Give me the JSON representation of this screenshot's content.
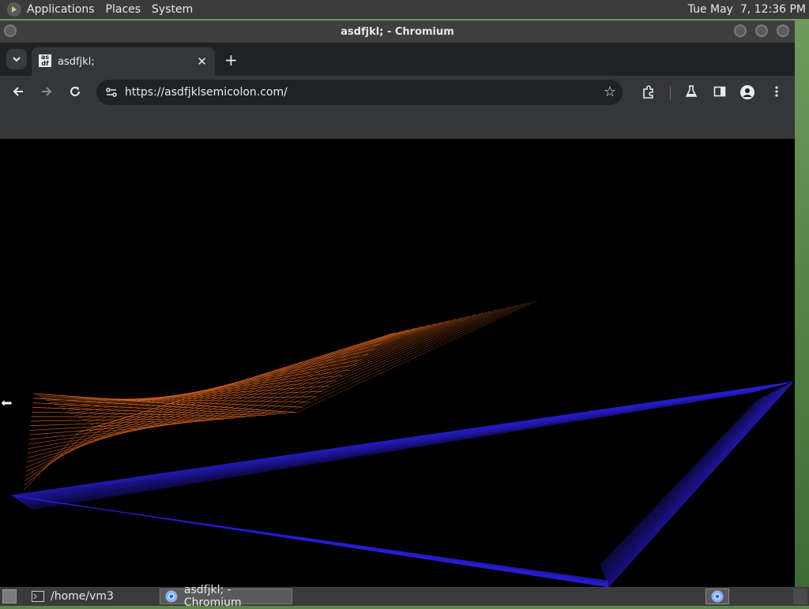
{
  "top_panel": {
    "menus": [
      "Applications",
      "Places",
      "System"
    ],
    "clock": "Tue May  7, 12:36 PM"
  },
  "window": {
    "title": "asdfjkl; - Chromium"
  },
  "browser": {
    "tab": {
      "favicon_text": "as df",
      "title": "asdfjkl;"
    },
    "new_tab": "+",
    "url": "https://asdfjklsemicolon.com/"
  },
  "content": {
    "background": "#000000",
    "orange": "#e0661e",
    "blue": "#2a1fd8"
  },
  "taskbar": {
    "items": [
      {
        "label": "/home/vm3"
      },
      {
        "label": "asdfjkl; - Chromium"
      }
    ]
  },
  "icons": [
    "distro-logo-icon",
    "tab-list-icon",
    "favicon-icon",
    "close-tab-icon",
    "new-tab-icon",
    "back-icon",
    "forward-icon",
    "reload-icon",
    "site-info-icon",
    "star-icon",
    "extensions-icon",
    "labs-icon",
    "side-panel-icon",
    "profile-icon",
    "menu-icon",
    "terminal-icon",
    "chromium-icon",
    "show-desktop-icon"
  ]
}
